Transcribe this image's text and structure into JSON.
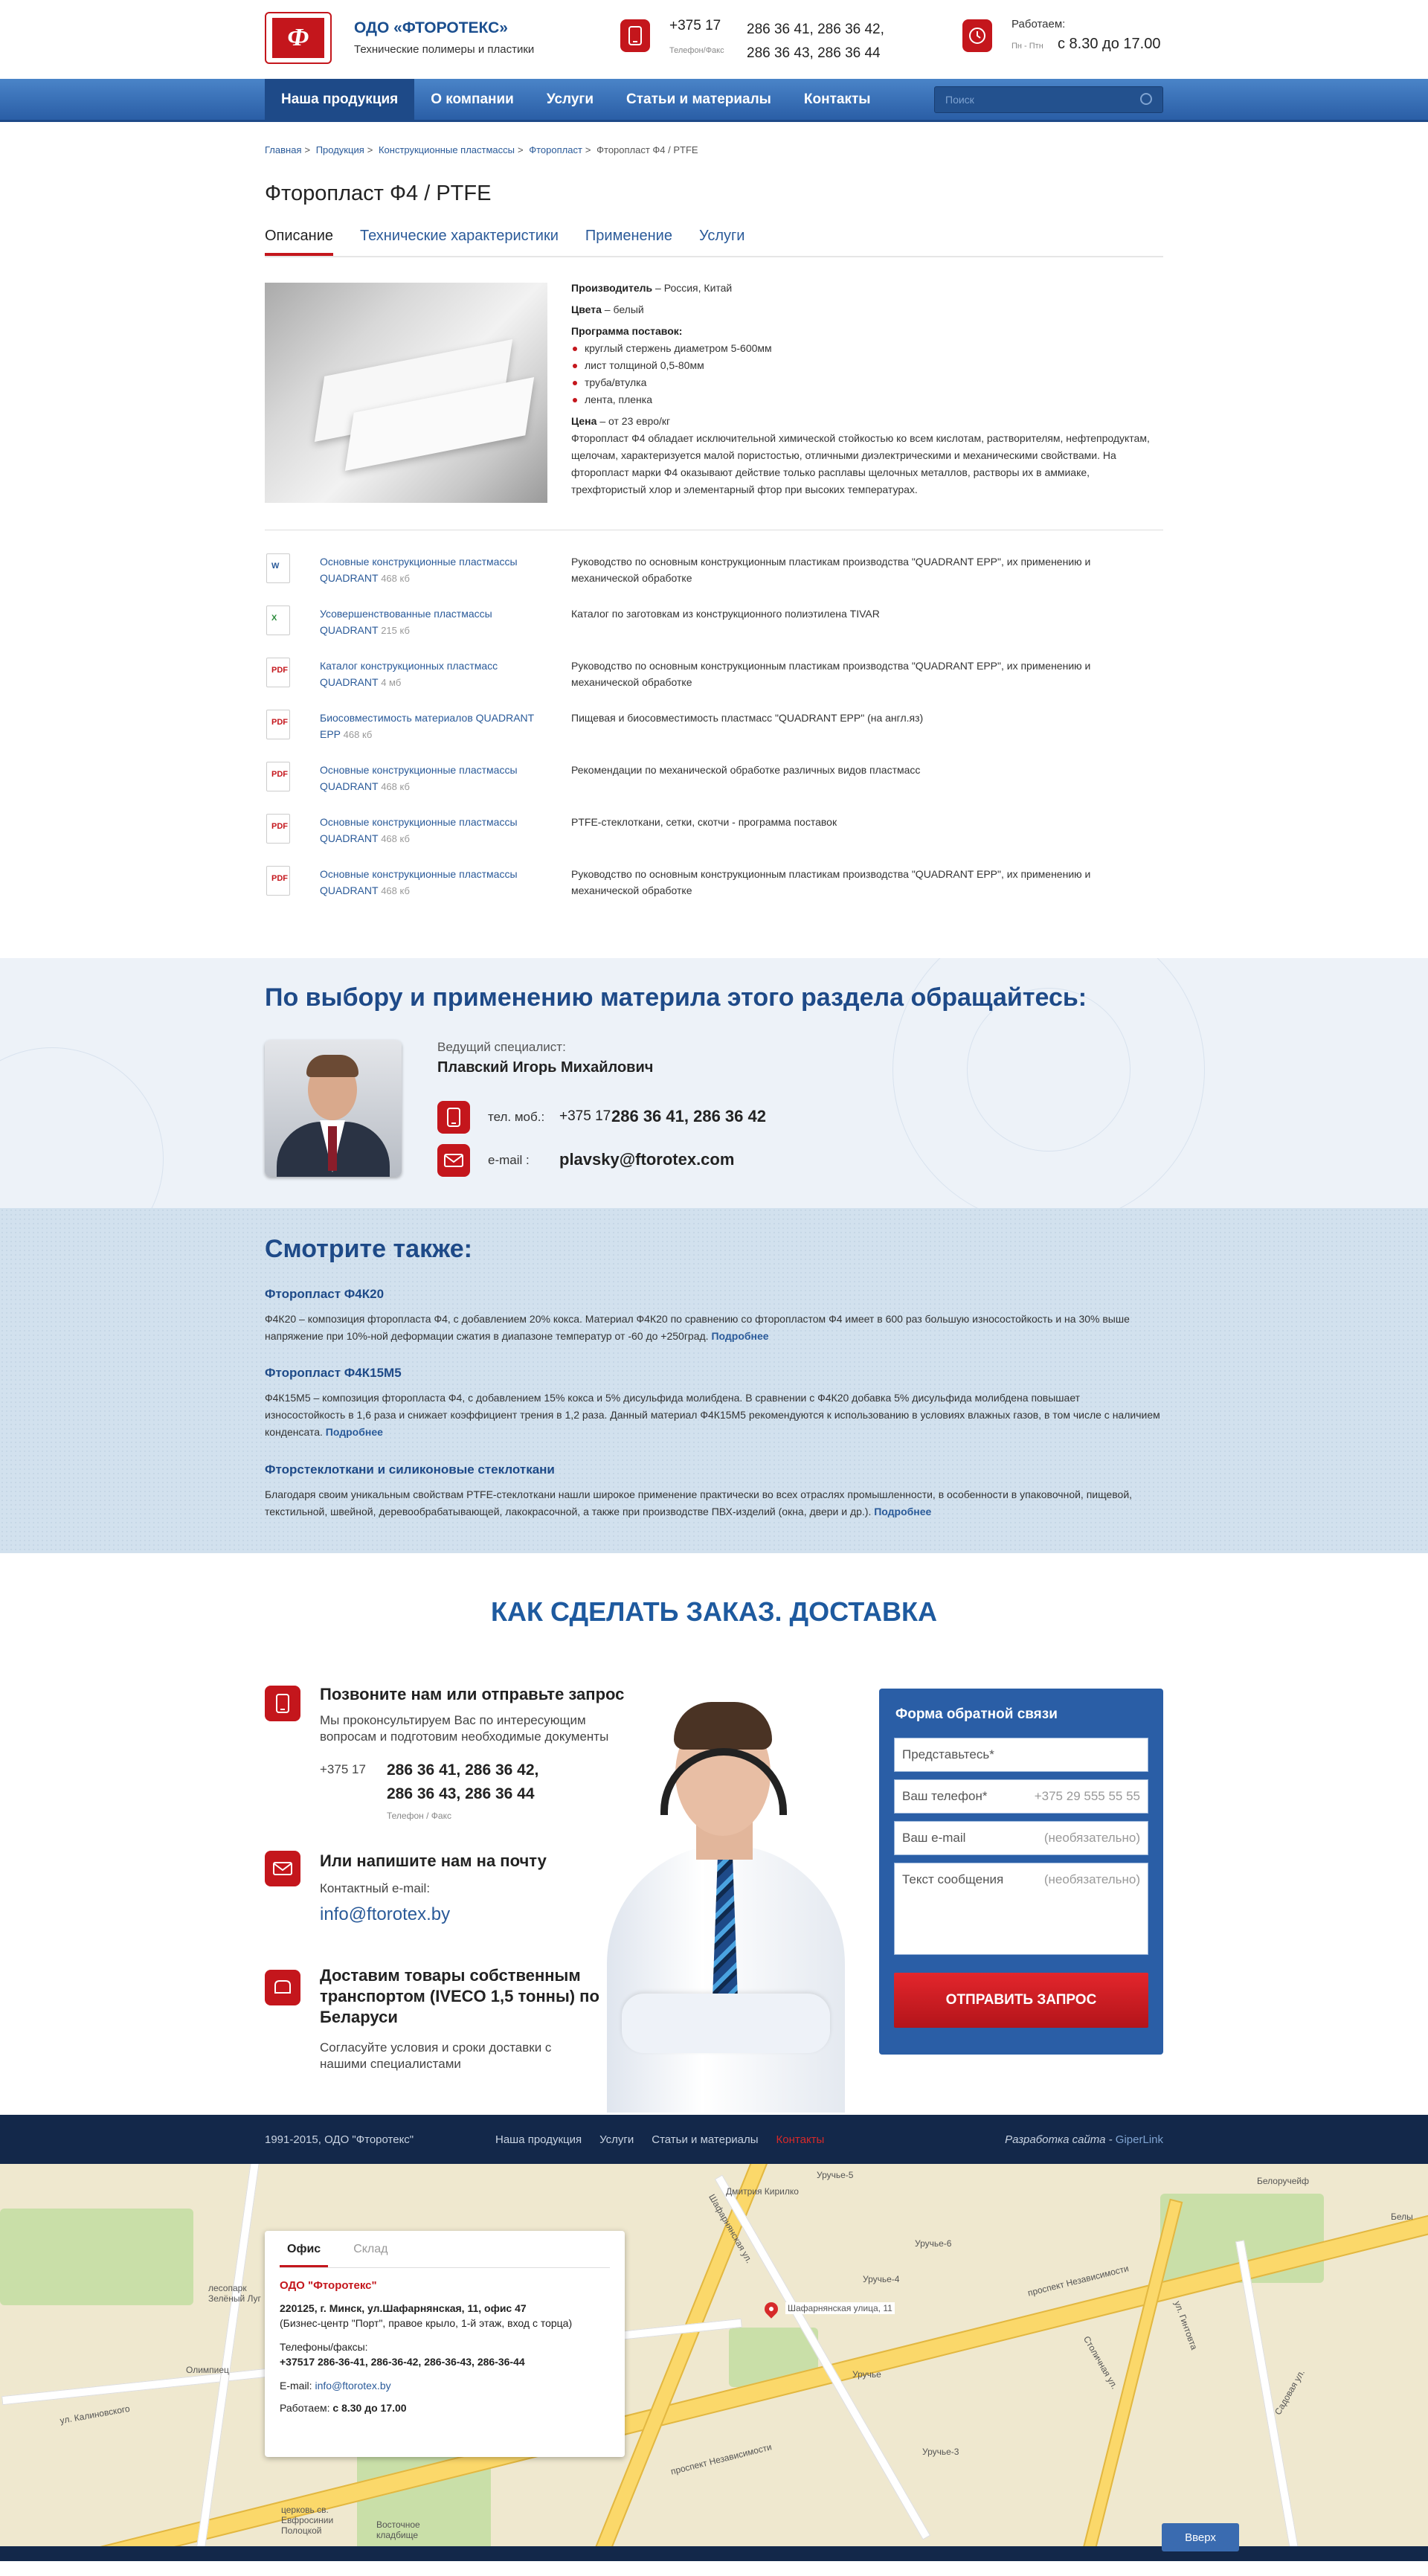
{
  "header": {
    "brand": "ОДО «ФТОРОТЕКС»",
    "tagline": "Технические полимеры и пластики",
    "phone_code": "+375 17",
    "phone_numbers_1": "286 36 41, 286 36 42,",
    "phone_numbers_2": "286 36 43, 286 36 44",
    "phone_label": "Телефон/Факс",
    "work_label": "Работаем:",
    "work_days": "Пн - Птн",
    "work_time": "с 8.30 до 17.00"
  },
  "nav": {
    "items": [
      "Наша продукция",
      "О компании",
      "Услуги",
      "Статьи и материалы",
      "Контакты"
    ],
    "search_placeholder": "Поиск"
  },
  "breadcrumb": [
    "Главная",
    "Продукция",
    "Конструкционные пластмассы",
    "Фторопласт",
    "Фторопласт Ф4 / PTFE"
  ],
  "breadcrumb_sep": ">",
  "page_title": "Фторопласт Ф4 / PTFE",
  "tabs": [
    "Описание",
    "Технические характеристики",
    "Применение",
    "Услуги"
  ],
  "product": {
    "maker_label": "Производитель",
    "maker_value": " – Россия, Китай",
    "color_label": "Цвета",
    "color_value": " – белый",
    "program_label": "Программа поставок:",
    "program": [
      "круглый стержень диаметром 5-600мм",
      "лист толщиной 0,5-80мм",
      "труба/втулка",
      "лента, пленка"
    ],
    "price_label": "Цена",
    "price_value": " – от 23 евро/кг",
    "description": "Фторопласт Ф4 обладает исключительной химической стойкостью ко всем кислотам, растворителям, нефтепродуктам, щелочам, характеризуется малой пористостью, отличными диэлектрическими и механическими свойствами. На фторопласт марки Ф4 оказывают действие только расплавы щелочных металлов, растворы их в аммиаке, трехфтористый хлор и элементарный фтор при высоких температурах."
  },
  "docs": [
    {
      "type": "doc",
      "title": "Основные конструкционные пластмассы QUADRANT",
      "size": "468 кб",
      "desc": "Руководство по основным конструкционным пластикам производства \"QUADRANT EPP\", их применению и механической обработке"
    },
    {
      "type": "xls",
      "title": "Усовершенствованные пластмассы QUADRANT",
      "size": "215 кб",
      "desc": "Каталог по заготовкам из конструкционного полиэтилена TIVAR"
    },
    {
      "type": "pdf",
      "title": "Каталог конструкционных пластмасс QUADRANT",
      "size": "4 мб",
      "desc": "Руководство по основным конструкционным пластикам производства \"QUADRANT EPP\", их применению и механической обработке"
    },
    {
      "type": "pdf",
      "title": "Биосовместимость материалов QUADRANT EPP",
      "size": "468 кб",
      "desc": "Пищевая и биосовместимость пластмасс \"QUADRANT EPP\" (на англ.яз)"
    },
    {
      "type": "pdf",
      "title": "Основные конструкционные пластмассы QUADRANT",
      "size": "468 кб",
      "desc": "Рекомендации по механической обработке различных видов пластмасс"
    },
    {
      "type": "pdf",
      "title": "Основные конструкционные пластмассы QUADRANT",
      "size": "468 кб",
      "desc": "PTFE-стеклоткани, сетки, скотчи - программа поставок"
    },
    {
      "type": "pdf",
      "title": "Основные конструкционные пластмассы QUADRANT",
      "size": "468 кб",
      "desc": "Руководство по основным конструкционным пластикам производства \"QUADRANT EPP\", их применению и механической обработке"
    }
  ],
  "contact": {
    "heading": "По выбору и применению материла этого раздела обращайтесь:",
    "role": "Ведущий специалист:",
    "name": "Плавский Игорь Михайлович",
    "phone_label": "тел. моб.:",
    "phone_code": "+375 17",
    "phone_value": "286 36 41, 286 36 42",
    "email_label": "e-mail :",
    "email_value": "plavsky@ftorotex.com"
  },
  "see_also": {
    "heading": "Смотрите также:",
    "more": "Подробнее",
    "items": [
      {
        "title": "Фторопласт Ф4К20",
        "text": "Ф4К20 – композиция фторопласта Ф4, с добавлением 20% кокса. Материал Ф4К20 по сравнению со фторопластом Ф4 имеет в 600 раз большую износостойкость и на 30% выше напряжение при 10%-ной деформации сжатия в диапазоне температур от -60 до +250град."
      },
      {
        "title": "Фторопласт Ф4К15М5",
        "text": "Ф4К15М5 – композиция фторопласта Ф4, с добавлением 15% кокса и 5% дисульфида молибдена. В сравнении с Ф4К20 добавка 5% дисульфида молибдена повышает износостойкость в 1,6 раза и снижает коэффициент трения в 1,2 раза. Данный материал Ф4К15М5 рекомендуются к использованию в условиях влажных газов, в том числе с наличием конденсата."
      },
      {
        "title": "Фторстеклоткани и силиконовые стеклоткани",
        "text": "Благодаря своим уникальным свойствам PTFE-стеклоткани нашли широкое применение практически во всех отраслях промышленности, в особенности в упаковочной, пищевой, текстильной, швейной,  деревообрабатывающей, лакокрасочной, а также при производстве ПВХ-изделий (окна, двери и др.)."
      }
    ]
  },
  "order": {
    "heading": "КАК СДЕЛАТЬ ЗАКАЗ. ДОСТАВКА",
    "call_title": "Позвоните нам или отправьте запрос",
    "call_text": "Мы проконсультируем Вас по интересующим вопросам и подготовим необходимые документы",
    "call_code": "+375 17",
    "call_numbers_1": "286 36 41, 286 36 42,",
    "call_numbers_2": "286 36 43, 286 36 44",
    "call_label": "Телефон / Факс",
    "mail_title": "Или напишите нам на почту",
    "mail_label": "Контактный e-mail:",
    "mail_value": "info@ftorotex.by",
    "deliver_title": "Доставим товары собственным транспортом (IVECO 1,5 тонны) по Беларуси",
    "deliver_text": "Согласуйте условия и сроки доставки с нашими специалистами"
  },
  "form": {
    "title": "Форма обратной связи",
    "name_label": "Представьтесь*",
    "phone_label": "Ваш телефон*",
    "phone_hint": "+375 29 555 55 55",
    "email_label": "Ваш e-mail",
    "email_hint": "(необязательно)",
    "msg_label": "Текст сообщения",
    "msg_hint": "(необязательно)",
    "submit": "ОТПРАВИТЬ ЗАПРОС"
  },
  "footer": {
    "copyright": "1991-2015, ОДО \"Фторотекс\"",
    "links": [
      "Наша продукция",
      "Услуги",
      "Статьи и материалы",
      "Контакты"
    ],
    "dev_label": "Разработка сайта -",
    "dev_link": "GiperLink"
  },
  "map": {
    "tabs": [
      "Офис",
      "Склад"
    ],
    "company": "ОДО \"Фторотекс\"",
    "address": "220125, г. Минск, ул.Шафарнянская, 11, офис 47",
    "address_note": "(Бизнес-центр \"Порт\", правое крыло, 1-й этаж, вход с торца)",
    "phones_label": "Телефоны/факсы:",
    "phones": "+37517 286-36-41, 286-36-42, 286-36-43, 286-36-44",
    "email_label": "E-mail:",
    "email": "info@ftorotex.by",
    "work_label": "Работаем:",
    "work_time": "с 8.30 до 17.00",
    "pin_label": "Шафарнянская улица, 11",
    "labels": [
      "Уручье-5",
      "Уручье-6",
      "Уручье-4",
      "Уручье-3",
      "Уручье",
      "Белоручейф",
      "Белы",
      "проспект Независимости",
      "проспект Независимости",
      "Дмитрия Кирилко",
      "Шафарнянская ул.",
      "Олимпиец",
      "ул. Калиновского",
      "лесопарк Зелёный Луг",
      "Восточное кладбище",
      "церковь св. Евфросинии Полоцкой",
      "Садовая ул.",
      "Столичная ул.",
      "ул. Гинтовта"
    ],
    "up_label": "Вверх"
  }
}
